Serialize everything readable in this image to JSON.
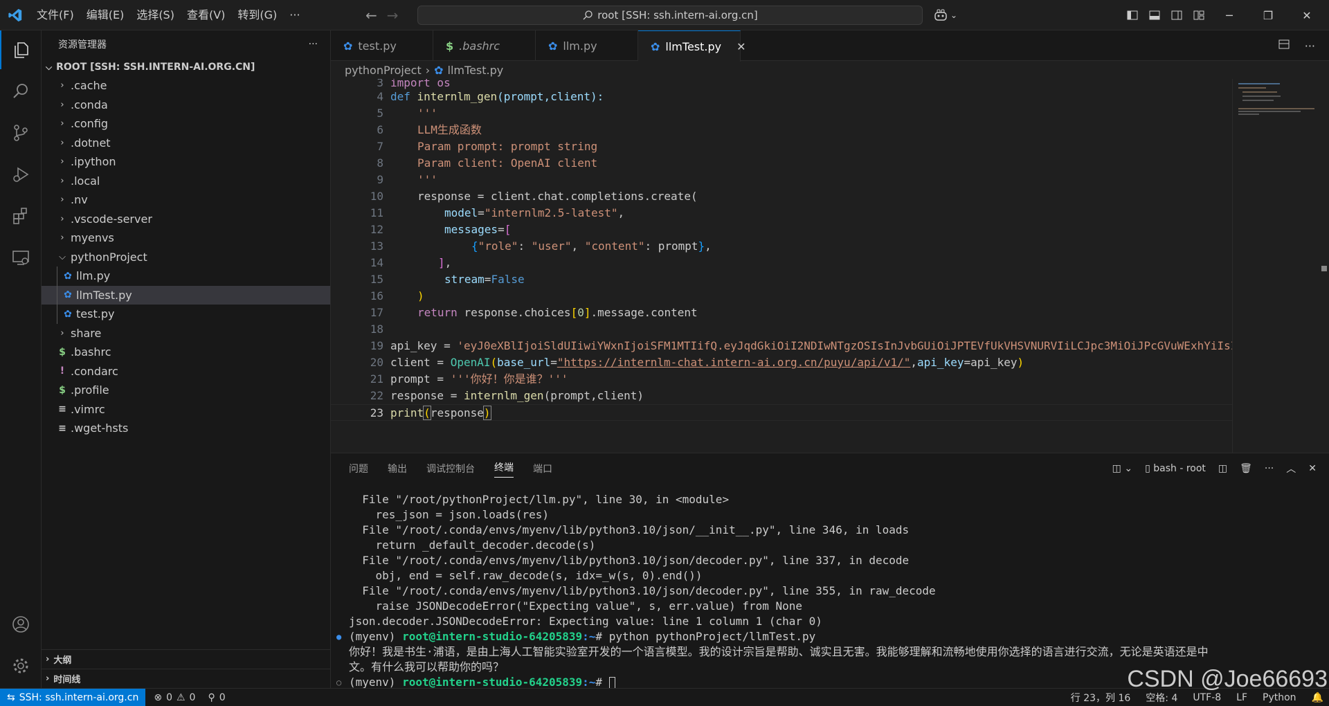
{
  "titlebar": {
    "menus": [
      "文件(F)",
      "编辑(E)",
      "选择(S)",
      "查看(V)",
      "转到(G)",
      "···"
    ],
    "search": "root [SSH: ssh.intern-ai.org.cn]"
  },
  "sidebar": {
    "title": "资源管理器",
    "more": "···",
    "root_label": "ROOT [SSH: SSH.INTERN-AI.ORG.CN]",
    "items": [
      {
        "label": ".cache",
        "type": "folder"
      },
      {
        "label": ".conda",
        "type": "folder"
      },
      {
        "label": ".config",
        "type": "folder"
      },
      {
        "label": ".dotnet",
        "type": "folder"
      },
      {
        "label": ".ipython",
        "type": "folder"
      },
      {
        "label": ".local",
        "type": "folder"
      },
      {
        "label": ".nv",
        "type": "folder"
      },
      {
        "label": ".vscode-server",
        "type": "folder"
      },
      {
        "label": "myenvs",
        "type": "folder"
      },
      {
        "label": "pythonProject",
        "type": "folder-open"
      },
      {
        "label": "llm.py",
        "type": "py"
      },
      {
        "label": "llmTest.py",
        "type": "py"
      },
      {
        "label": "test.py",
        "type": "py"
      },
      {
        "label": "share",
        "type": "folder"
      },
      {
        "label": ".bashrc",
        "type": "sh"
      },
      {
        "label": ".condarc",
        "type": "yaml"
      },
      {
        "label": ".profile",
        "type": "sh"
      },
      {
        "label": ".vimrc",
        "type": "txt"
      },
      {
        "label": ".wget-hsts",
        "type": "txt"
      }
    ],
    "outline": "大纲",
    "timeline": "时间线"
  },
  "tabs": [
    {
      "label": "test.py",
      "icon": "python-icon"
    },
    {
      "label": ".bashrc",
      "icon": "shell-icon"
    },
    {
      "label": "llm.py",
      "icon": "python-icon"
    },
    {
      "label": "llmTest.py",
      "icon": "python-icon"
    }
  ],
  "breadcrumb": {
    "folder": "pythonProject",
    "file": "llmTest.py"
  },
  "code": {
    "line_numbers": [
      "3",
      "4",
      "5",
      "6",
      "7",
      "8",
      "9",
      "10",
      "11",
      "12",
      "13",
      "14",
      "15",
      "16",
      "17",
      "18",
      "19",
      "20",
      "21",
      "22",
      "23"
    ],
    "l3": "import os",
    "l4_def": "def ",
    "l4_fn": "internlm_gen",
    "l4_rest": "(prompt,client):",
    "l5": "'''",
    "l6": "LLM生成函数",
    "l7": "Param prompt: prompt string",
    "l8": "Param client: OpenAI client",
    "l9": "'''",
    "l10": "response = client.chat.completions.create(",
    "l11_par": "model",
    "l11_str": "\"internlm2.5-latest\"",
    "l12_par": "messages",
    "l13_a": "{",
    "l13_s1": "\"role\"",
    "l13_s2": "\"user\"",
    "l13_s3": "\"content\"",
    "l13_b": ": prompt",
    "l13_c": "}",
    "l14": "],",
    "l15_par": "stream",
    "l15_val": "False",
    "l16": ")",
    "l17_ret": "return ",
    "l17_a": "response.choices",
    "l17_num": "0",
    "l17_b": ".message.content",
    "l19_a": "api_key = ",
    "l19_str": "'eyJ0eXBlIjoiSldUIiwiYWxnIjoiSFM1MTIifQ.eyJqdGkiOiI2NDIwNTgzOSIsInJvbGUiOiJPTEVfUkVHSVNURVIiLCJpc3MiOiJPcGVuWExhYiIsI",
    "l20_a": "client = ",
    "l20_cls": "OpenAI",
    "l20_par1": "base_url",
    "l20_url": "\"https://internlm-chat.intern-ai.org.cn/puyu/api/v1/\"",
    "l20_par2": "api_key",
    "l20_end": "=api_key",
    "l21_a": "prompt = ",
    "l21_str": "'''你好！你是谁？'''",
    "l22_a": "response = ",
    "l22_fn": "internlm_gen",
    "l22_b": "(prompt,client)",
    "l23_fn": "print",
    "l23_b": "response"
  },
  "panel": {
    "tabs": [
      "问题",
      "输出",
      "调试控制台",
      "终端",
      "端口"
    ],
    "terminal_name": "bash - root",
    "lines": [
      "  File \"/root/pythonProject/llm.py\", line 30, in <module>",
      "    res_json = json.loads(res)",
      "  File \"/root/.conda/envs/myenv/lib/python3.10/json/__init__.py\", line 346, in loads",
      "    return _default_decoder.decode(s)",
      "  File \"/root/.conda/envs/myenv/lib/python3.10/json/decoder.py\", line 337, in decode",
      "    obj, end = self.raw_decode(s, idx=_w(s, 0).end())",
      "  File \"/root/.conda/envs/myenv/lib/python3.10/json/decoder.py\", line 355, in raw_decode",
      "    raise JSONDecodeError(\"Expecting value\", s, err.value) from None",
      "json.decoder.JSONDecodeError: Expecting value: line 1 column 1 (char 0)"
    ],
    "prompt_env": "(myenv) ",
    "prompt_user": "root@intern-studio-64205839",
    "prompt_path": ":~",
    "cmd": "# python pythonProject/llmTest.py",
    "output1": "你好！我是书生·浦语，是由上海人工智能实验室开发的一个语言模型。我的设计宗旨是帮助、诚实且无害。我能够理解和流畅地使用你选择的语言进行交流，无论是英语还是中",
    "output2": "文。有什么我可以帮助你的吗？",
    "prompt_end": "# "
  },
  "statusbar": {
    "remote": "SSH: ssh.intern-ai.org.cn",
    "errors": "0",
    "warnings": "0",
    "ports": "0",
    "position": "行 23，列 16",
    "spaces": "空格: 4",
    "encoding": "UTF-8",
    "eol": "LF",
    "language": "Python"
  },
  "watermark": "CSDN @Joe66693",
  "colors": {
    "accent": "#0078d4",
    "python_icon": "#3b8eea",
    "shell_icon": "#89d185",
    "yaml_icon": "#c586c0"
  }
}
